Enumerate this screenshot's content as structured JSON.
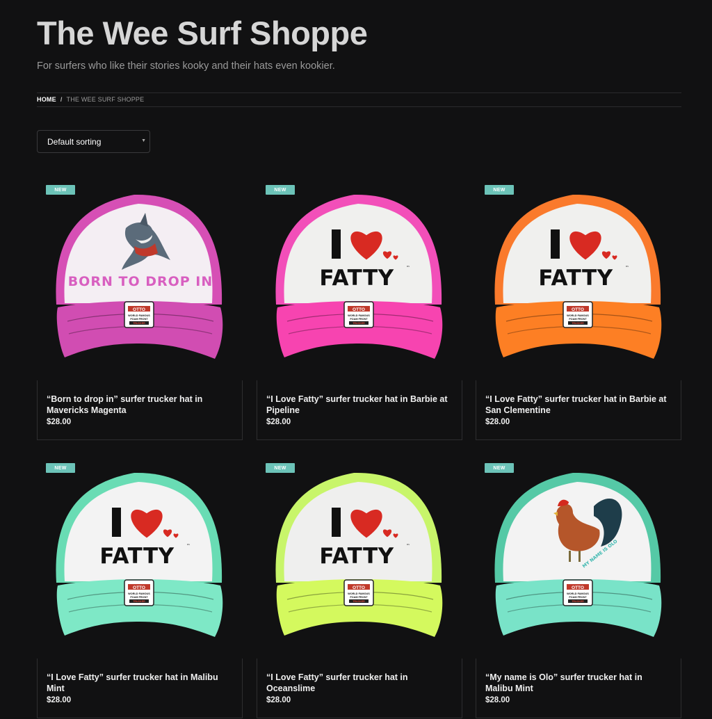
{
  "site": {
    "title": "The Wee Surf Shoppe",
    "tagline": "For surfers who like their stories kooky and their hats even kookier."
  },
  "breadcrumb": {
    "home": "HOME",
    "separator": "/",
    "current": "THE WEE SURF SHOPPE"
  },
  "sorting": {
    "selected": "Default sorting"
  },
  "products": [
    {
      "badge": "NEW",
      "title": "“Born to drop in” surfer trucker hat in Mavericks Magenta",
      "price": "$28.00",
      "front_color": "#f4eef3",
      "mesh_color": "#d64fb5",
      "brim_color": "#d14db2",
      "graphic": "shark",
      "graphic_text": "BORN TO DROP IN",
      "graphic_text_color": "#d85fc0"
    },
    {
      "badge": "NEW",
      "title": "“I Love Fatty” surfer trucker hat in Barbie at Pipeline",
      "price": "$28.00",
      "front_color": "#f0f0ee",
      "mesh_color": "#f24fb9",
      "brim_color": "#f744b0",
      "graphic": "fatty",
      "graphic_text": "FATTY",
      "graphic_text_color": "#111111"
    },
    {
      "badge": "NEW",
      "title": "“I Love Fatty” surfer trucker hat in Barbie at San Clementine",
      "price": "$28.00",
      "front_color": "#f0f0ee",
      "mesh_color": "#fa7a2c",
      "brim_color": "#fd7f24",
      "graphic": "fatty",
      "graphic_text": "FATTY",
      "graphic_text_color": "#111111"
    },
    {
      "badge": "NEW",
      "title": "“I Love Fatty” surfer trucker hat in Malibu Mint",
      "price": "$28.00",
      "front_color": "#f3f3f3",
      "mesh_color": "#69dcb4",
      "brim_color": "#7ee8c6",
      "graphic": "fatty",
      "graphic_text": "FATTY",
      "graphic_text_color": "#111111"
    },
    {
      "badge": "NEW",
      "title": "“I Love Fatty” surfer trucker hat in Oceanslime",
      "price": "$28.00",
      "front_color": "#efefee",
      "mesh_color": "#c8f56a",
      "brim_color": "#d4f95e",
      "graphic": "fatty",
      "graphic_text": "FATTY",
      "graphic_text_color": "#111111"
    },
    {
      "badge": "NEW",
      "title": "“My name is Olo” surfer trucker hat in Malibu Mint",
      "price": "$28.00",
      "front_color": "#f3f3f3",
      "mesh_color": "#55c9a6",
      "brim_color": "#79e3c8",
      "graphic": "rooster",
      "graphic_text": "MY NAME IS OLO",
      "graphic_text_color": "#3cb8b0"
    }
  ],
  "patch": {
    "brand": "OTTO",
    "line1": "WORLD FAMOUS",
    "line2": "FOAM FRONT",
    "sub": "TRUCKER"
  },
  "heart_color": "#d82a22"
}
